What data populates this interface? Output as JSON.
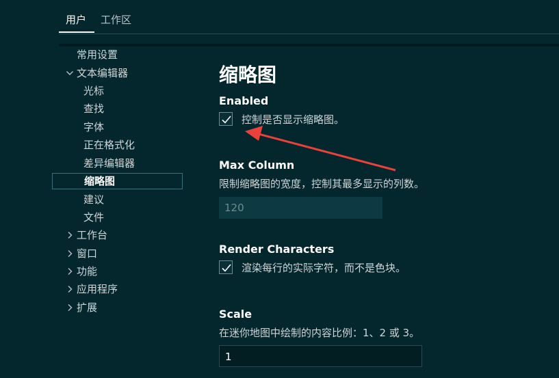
{
  "tabs": {
    "user": "用户",
    "workspace": "工作区"
  },
  "sidebar": {
    "items": [
      {
        "label": "常用设置",
        "chevron": ""
      },
      {
        "label": "文本编辑器",
        "chevron": "﹀"
      },
      {
        "label": "光标",
        "chevron": ""
      },
      {
        "label": "查找",
        "chevron": ""
      },
      {
        "label": "字体",
        "chevron": ""
      },
      {
        "label": "正在格式化",
        "chevron": ""
      },
      {
        "label": "差异编辑器",
        "chevron": ""
      },
      {
        "label": "缩略图",
        "chevron": ""
      },
      {
        "label": "建议",
        "chevron": ""
      },
      {
        "label": "文件",
        "chevron": ""
      },
      {
        "label": "工作台",
        "chevron": "›"
      },
      {
        "label": "窗口",
        "chevron": "›"
      },
      {
        "label": "功能",
        "chevron": "›"
      },
      {
        "label": "应用程序",
        "chevron": "›"
      },
      {
        "label": "扩展",
        "chevron": "›"
      }
    ]
  },
  "main": {
    "section_title": "缩略图",
    "settings": {
      "enabled": {
        "title": "Enabled",
        "description": "控制是否显示缩略图。",
        "checked": true
      },
      "max_column": {
        "title": "Max Column",
        "description": "限制缩略图的宽度，控制其最多显示的列数。",
        "value": "120"
      },
      "render_characters": {
        "title": "Render Characters",
        "description": "渲染每行的实际字符，而不是色块。",
        "checked": true
      },
      "scale": {
        "title": "Scale",
        "description": "在迷你地图中绘制的内容比例：1、2 或 3。",
        "value": "1"
      }
    }
  },
  "colors": {
    "background": "#04262d",
    "annotation_arrow": "#e8423a",
    "selection_border": "#3d6f78"
  },
  "icons": {
    "checkbox": "checkmark-icon",
    "expanded": "chevron-down-icon",
    "collapsed": "chevron-right-icon"
  }
}
